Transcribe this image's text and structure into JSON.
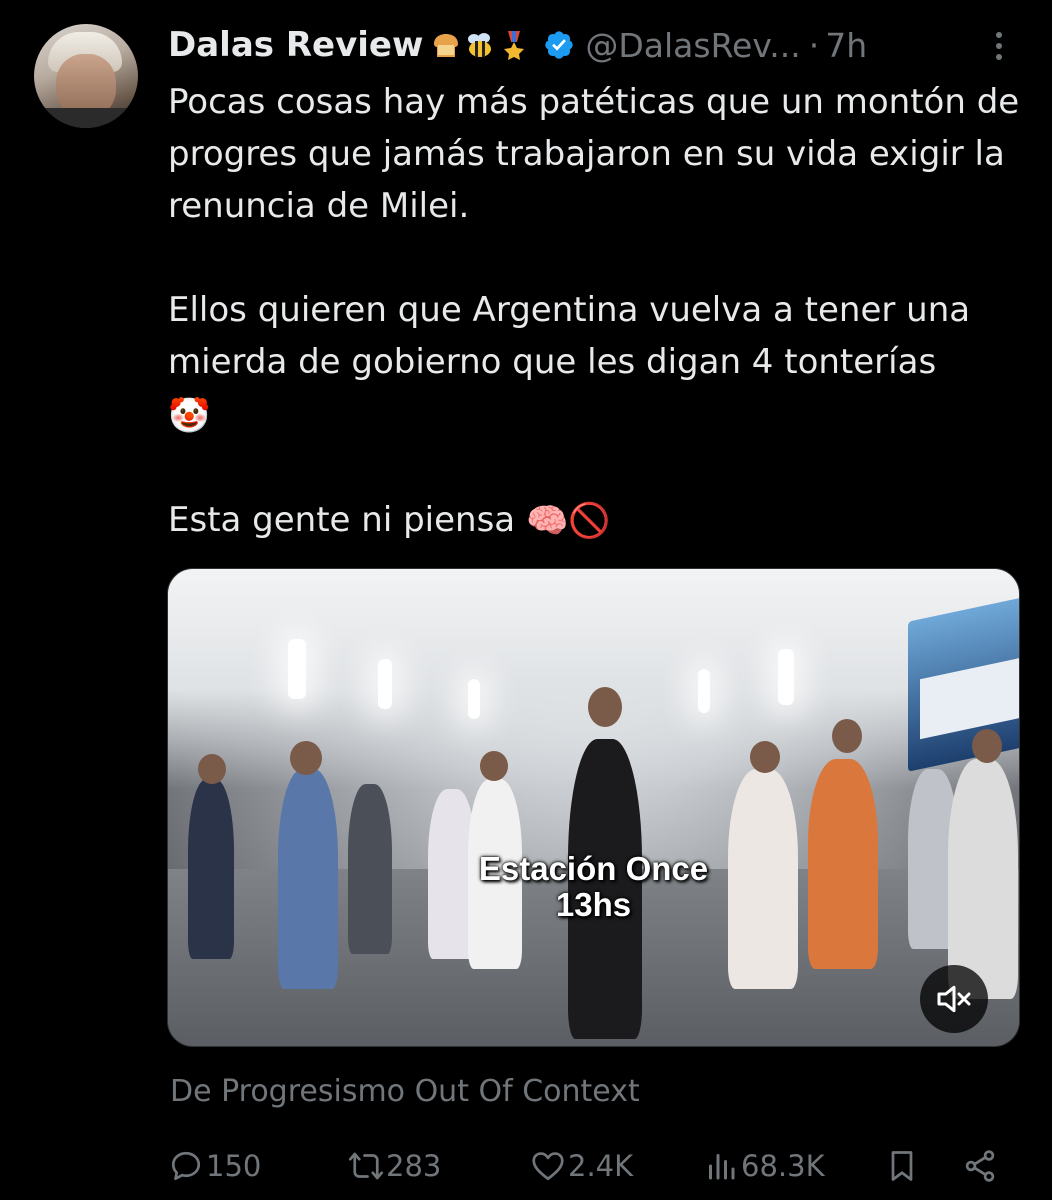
{
  "author": {
    "name": "Dalas Review",
    "badges": [
      "bread-emoji",
      "bee-emoji",
      "medal-emoji"
    ],
    "verified": true,
    "handle": "@DalasRev...",
    "separator": "·",
    "time": "7h"
  },
  "tweet": {
    "para1": "Pocas cosas hay más patéticas que un montón de progres que jamás trabajaron en su vida exigir la renuncia de Milei.",
    "para2": "Ellos quieren que Argentina vuelva a tener una mierda de gobierno que les digan 4 tonterías",
    "para2_emoji": "🤡",
    "para3": "Esta gente ni piensa",
    "para3_emojis": "🧠🚫"
  },
  "media": {
    "caption_line1": "Estación Once",
    "caption_line2": "13hs"
  },
  "source": "De Progresismo Out Of Context",
  "actions": {
    "replies": "150",
    "reposts": "283",
    "likes": "2.4K",
    "views": "68.3K"
  },
  "colors": {
    "background": "#000000",
    "text": "#e7e9ea",
    "muted": "#71767b",
    "verified": "#1d9bf0"
  }
}
